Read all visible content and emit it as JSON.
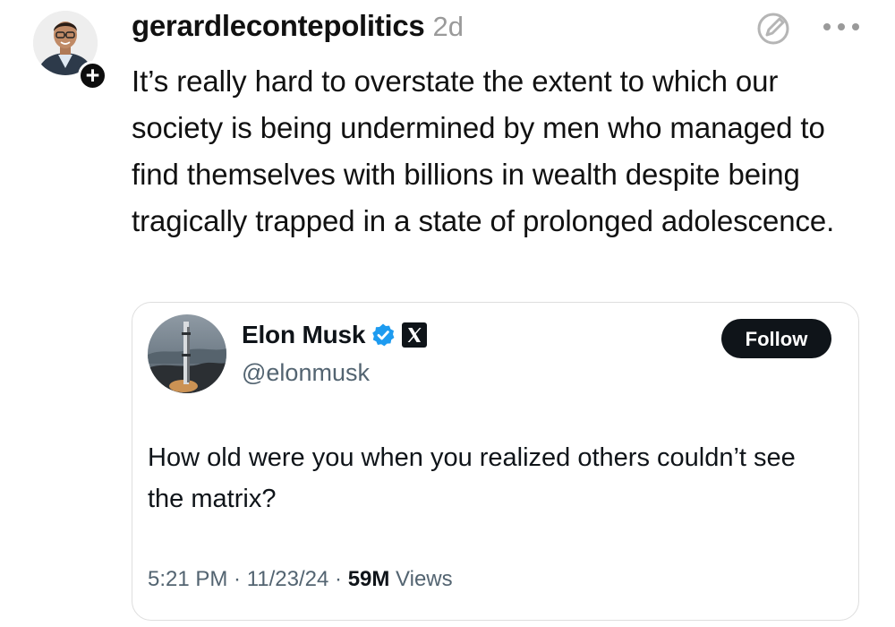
{
  "post": {
    "username": "gerardlecontepolitics",
    "timestamp": "2d",
    "text": "It’s really hard to overstate the extent to which our society is being undermined by men who managed to find themselves with billions in wealth despite being tragically trapped in a state of prolonged adolescence.",
    "avatar_icon": "person-avatar",
    "follow_icon": "plus-icon",
    "action_icons": [
      "edit-icon",
      "more-icon"
    ]
  },
  "quoted_tweet": {
    "name": "Elon Musk",
    "handle": "@elonmusk",
    "verified": true,
    "follow_label": "Follow",
    "text": "How old were you when you realized others couldn’t see the matrix?",
    "time": "5:21 PM",
    "date": "11/23/24",
    "views_count": "59M",
    "views_label": "Views",
    "separator": " · "
  },
  "colors": {
    "verified_blue": "#1d9bf0",
    "follow_button": "#0f1419",
    "muted_text": "#536471",
    "timestamp_gray": "#9a9a9a"
  }
}
